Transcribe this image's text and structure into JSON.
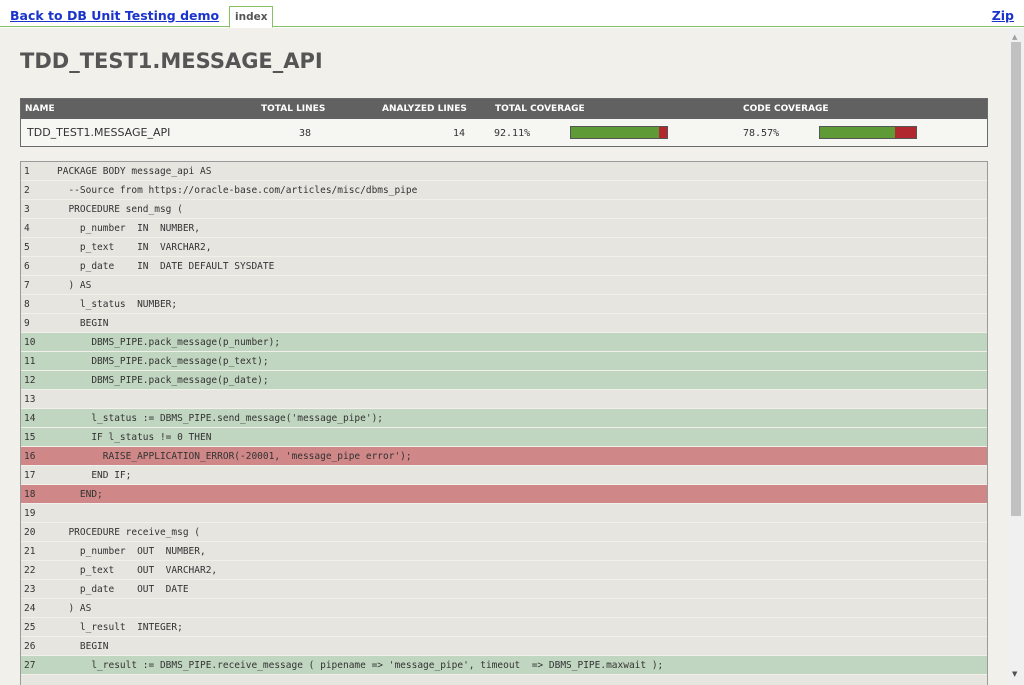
{
  "nav": {
    "back_label": "Back to DB Unit Testing demo",
    "tab_label": "index",
    "zip_label": "Zip"
  },
  "page": {
    "title": "TDD_TEST1.MESSAGE_API"
  },
  "coverage": {
    "headers": {
      "name": "NAME",
      "total_lines": "TOTAL LINES",
      "analyzed_lines": "ANALYZED LINES",
      "total_coverage": "TOTAL COVERAGE",
      "code_coverage": "CODE COVERAGE"
    },
    "row": {
      "name": "TDD_TEST1.MESSAGE_API",
      "total_lines": "38",
      "analyzed_lines": "14",
      "total_coverage": "92.11%",
      "total_coverage_fraction": 0.9211,
      "code_coverage": "78.57%",
      "code_coverage_fraction": 0.7857
    },
    "colors": {
      "covered": "#5e9a35",
      "uncovered": "#b2282f"
    }
  },
  "source": {
    "lines": [
      {
        "n": "1",
        "text": "PACKAGE BODY message_api AS",
        "status": "none"
      },
      {
        "n": "2",
        "text": "  --Source from https://oracle-base.com/articles/misc/dbms_pipe",
        "status": "none"
      },
      {
        "n": "3",
        "text": "  PROCEDURE send_msg (",
        "status": "none"
      },
      {
        "n": "4",
        "text": "    p_number  IN  NUMBER,",
        "status": "none"
      },
      {
        "n": "5",
        "text": "    p_text    IN  VARCHAR2,",
        "status": "none"
      },
      {
        "n": "6",
        "text": "    p_date    IN  DATE DEFAULT SYSDATE",
        "status": "none"
      },
      {
        "n": "7",
        "text": "  ) AS",
        "status": "none"
      },
      {
        "n": "8",
        "text": "    l_status  NUMBER;",
        "status": "none"
      },
      {
        "n": "9",
        "text": "    BEGIN",
        "status": "none"
      },
      {
        "n": "10",
        "text": "      DBMS_PIPE.pack_message(p_number);",
        "status": "covered"
      },
      {
        "n": "11",
        "text": "      DBMS_PIPE.pack_message(p_text);",
        "status": "covered"
      },
      {
        "n": "12",
        "text": "      DBMS_PIPE.pack_message(p_date);",
        "status": "covered"
      },
      {
        "n": "13",
        "text": "",
        "status": "none"
      },
      {
        "n": "14",
        "text": "      l_status := DBMS_PIPE.send_message('message_pipe');",
        "status": "covered"
      },
      {
        "n": "15",
        "text": "      IF l_status != 0 THEN",
        "status": "covered"
      },
      {
        "n": "16",
        "text": "        RAISE_APPLICATION_ERROR(-20001, 'message_pipe error');",
        "status": "uncovered"
      },
      {
        "n": "17",
        "text": "      END IF;",
        "status": "none"
      },
      {
        "n": "18",
        "text": "    END;",
        "status": "uncovered"
      },
      {
        "n": "19",
        "text": "",
        "status": "none"
      },
      {
        "n": "20",
        "text": "  PROCEDURE receive_msg (",
        "status": "none"
      },
      {
        "n": "21",
        "text": "    p_number  OUT  NUMBER,",
        "status": "none"
      },
      {
        "n": "22",
        "text": "    p_text    OUT  VARCHAR2,",
        "status": "none"
      },
      {
        "n": "23",
        "text": "    p_date    OUT  DATE",
        "status": "none"
      },
      {
        "n": "24",
        "text": "  ) AS",
        "status": "none"
      },
      {
        "n": "25",
        "text": "    l_result  INTEGER;",
        "status": "none"
      },
      {
        "n": "26",
        "text": "    BEGIN",
        "status": "none"
      },
      {
        "n": "27",
        "text": "      l_result := DBMS_PIPE.receive_message ( pipename => 'message_pipe', timeout  => DBMS_PIPE.maxwait );",
        "status": "covered"
      }
    ]
  },
  "icons": {
    "scroll_up": "triangle-up-icon",
    "scroll_down": "triangle-down-icon"
  }
}
